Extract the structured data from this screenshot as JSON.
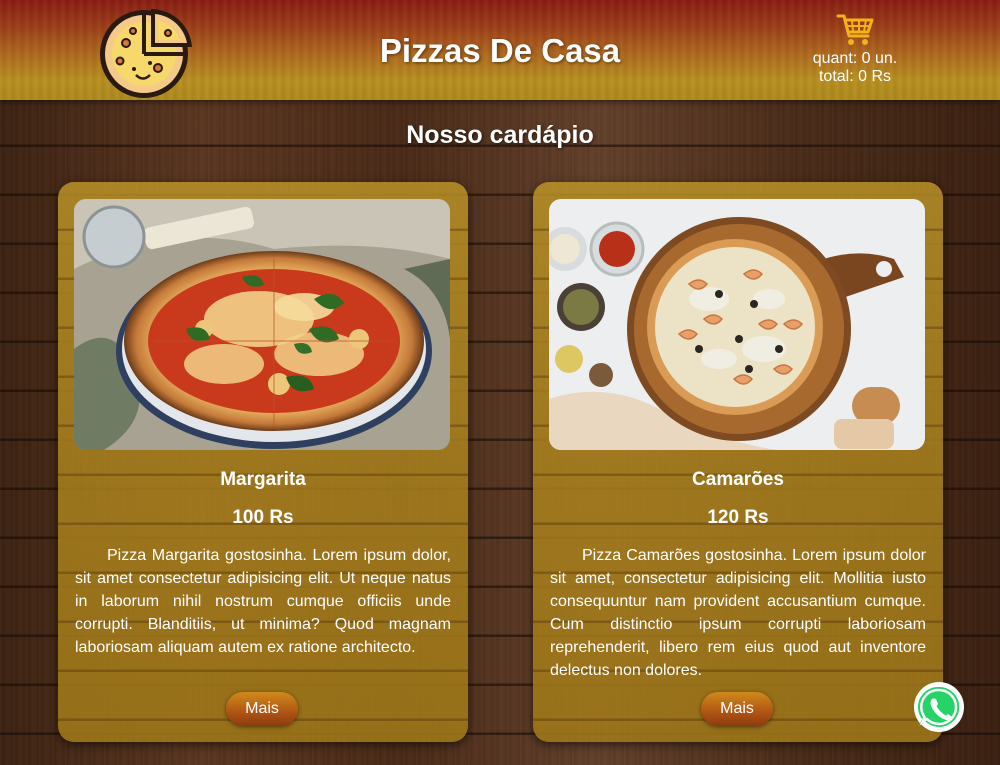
{
  "header": {
    "logo_icon": "pizza-logo-icon",
    "title": "Pizzas De Casa",
    "cart": {
      "icon": "cart-icon",
      "quantity_text": "quant: 0 un.",
      "total_text": "total: 0 Rs",
      "icon_color": "#f2b21a"
    }
  },
  "main": {
    "section_title": "Nosso cardápio",
    "products": [
      {
        "name": "Margarita",
        "price": "100 Rs",
        "description": "Pizza Margarita gostosinha. Lorem ipsum dolor, sit amet consectetur adipisicing elit. Ut neque natus in laborum nihil nostrum cumque officiis unde corrupti. Blanditiis, ut minima? Quod magnam laboriosam aliquam autem ex ratione architecto.",
        "button_label": "Mais",
        "image_icon": "margarita-pizza-photo"
      },
      {
        "name": "Camarões",
        "price": "120 Rs",
        "description": "Pizza Camarões gostosinha. Lorem ipsum dolor sit amet, consectetur adipisicing elit. Mollitia iusto consequuntur nam provident accusantium cumque. Cum distinctio ipsum corrupti laboriosam reprehenderit, libero rem eius quod aut inventore delectus non dolores.",
        "button_label": "Mais",
        "image_icon": "shrimp-pizza-photo"
      }
    ]
  },
  "floating": {
    "whatsapp_icon": "whatsapp-icon",
    "whatsapp_color": "#25d366"
  },
  "colors": {
    "header_top": "#8a1d12",
    "header_bottom": "#b8901f",
    "button": "#b25814",
    "card": "#b8902a"
  }
}
